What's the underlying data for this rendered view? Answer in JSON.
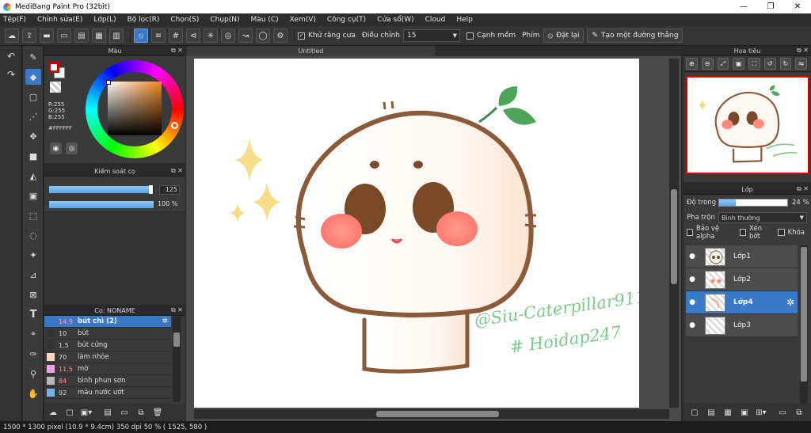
{
  "window": {
    "title": "MediBang Paint Pro (32bit)",
    "min": "—",
    "max": "❐",
    "close": "✕"
  },
  "menu": [
    "Tệp(F)",
    "Chỉnh sửa(E)",
    "Lớp(L)",
    "Bộ lọc(R)",
    "Chọn(S)",
    "Chụp(N)",
    "Màu (C)",
    "Xem(V)",
    "Công cụ(T)",
    "Cửa sổ(W)",
    "Cloud",
    "Help"
  ],
  "toolbar": {
    "antialias_label": "Khử răng cưa",
    "correction_label": "Điều chỉnh",
    "correction_value": "15",
    "soft_edge_label": "Cạnh mềm",
    "key_label": "Phím",
    "reset_label": "Đặt lại",
    "straight_line_label": "Tạo một đường thẳng"
  },
  "color_panel": {
    "title": "Màu",
    "r": "R:255",
    "g": "G:255",
    "b": "B:255",
    "hex": "#FFFFFF",
    "fg_color": "#FFFFFF",
    "border_color": "#CC0000"
  },
  "brush_control": {
    "title": "Kiểm soát cọ",
    "size_value": "125",
    "size_fraction": 0.98,
    "opacity_value": "100 %",
    "opacity_fraction": 1.0
  },
  "brush_list": {
    "title": "Cọ: NONAME",
    "items": [
      {
        "size": "14.9",
        "name": "bút chì (2)",
        "color": "#3a78c8",
        "selected": true
      },
      {
        "size": "10",
        "name": "bút",
        "color": "#333333",
        "selected": false
      },
      {
        "size": "1.5",
        "name": "bút cứng",
        "color": "#333333",
        "selected": false
      },
      {
        "size": "70",
        "name": "làm nhòe",
        "color": "#f3d9bf",
        "selected": false
      },
      {
        "size": "11.5",
        "name": "mờ",
        "color": "#f0a0e8",
        "selected": false
      },
      {
        "size": "84",
        "name": "bình phun sơn",
        "color": "#b9b9b9",
        "selected": false
      },
      {
        "size": "92",
        "name": "màu nước ướt",
        "color": "#7ab6ee",
        "selected": false
      }
    ]
  },
  "document": {
    "tab_title": "Untitled"
  },
  "canvas_text": {
    "signature_line1": "@Siu-Caterpillar911",
    "signature_line2": "# Hoidap247"
  },
  "navigator": {
    "title": "Hoa tiêu"
  },
  "layers": {
    "title": "Lớp",
    "opacity_label": "Độ trong",
    "opacity_value": "24 %",
    "opacity_fraction": 0.24,
    "blend_label": "Pha trộn",
    "blend_value": "Bình thường",
    "protect_alpha_label": "Bảo vệ alpha",
    "clipping_label": "Xén bớt",
    "lock_label": "Khóa",
    "items": [
      {
        "name": "Lớp1",
        "selected": false
      },
      {
        "name": "Lớp2",
        "selected": false
      },
      {
        "name": "Lớp4",
        "selected": true
      },
      {
        "name": "Lớp3",
        "selected": false
      }
    ]
  },
  "status": {
    "text": "1500 * 1300 pixel   (10.9 * 9.4cm)   350 dpi   50 %   ( 1525, 580 )"
  }
}
